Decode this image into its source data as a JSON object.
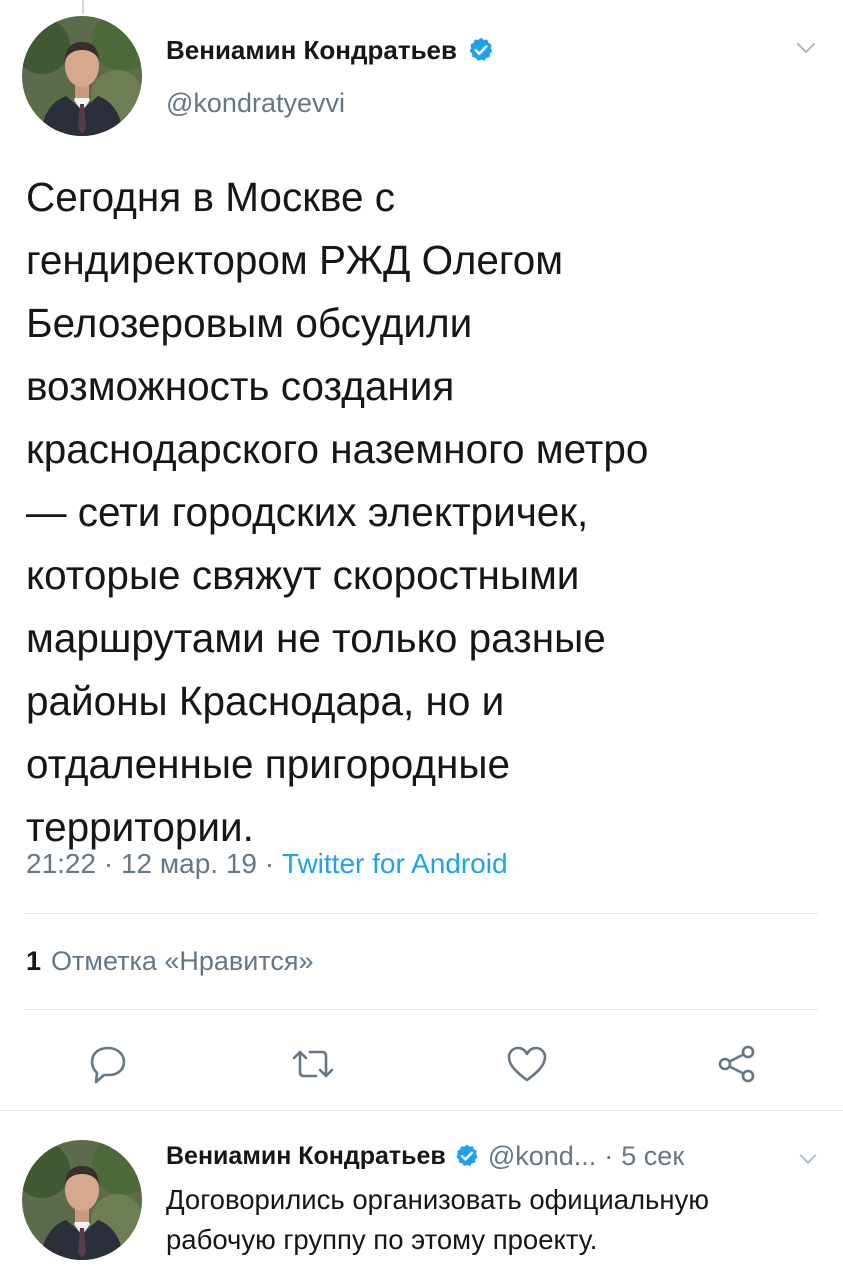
{
  "tweet": {
    "author_name": "Вениамин Кондратьев",
    "handle": "@kondratyevvi",
    "text": "Сегодня в Москве с\nгендиректором РЖД Олегом\nБелозеровым обсудили\nвозможность создания\nкраснодарского наземного метро\n— сети городских электричек,\nкоторые свяжут скоростными\nмаршрутами не только разные\nрайоны Краснодара, но и\nотдаленные пригородные\nтерритории.",
    "time": "21:22",
    "date": "12 мар. 19",
    "source": "Twitter for Android",
    "likes_count": "1",
    "likes_label": "Отметка «Нравится»"
  },
  "actions": [
    "reply-icon",
    "retweet-icon",
    "like-icon",
    "share-icon"
  ],
  "reply": {
    "author_name": "Вениамин Кондратьев",
    "handle": "@kond...",
    "time": "5 сек",
    "text": "Договорились организовать официальную\nрабочую группу по этому проекту."
  },
  "colors": {
    "accent": "#1da1f2",
    "secondary_text": "#657786",
    "icon": "#657786",
    "divider": "#e1e8ed"
  }
}
